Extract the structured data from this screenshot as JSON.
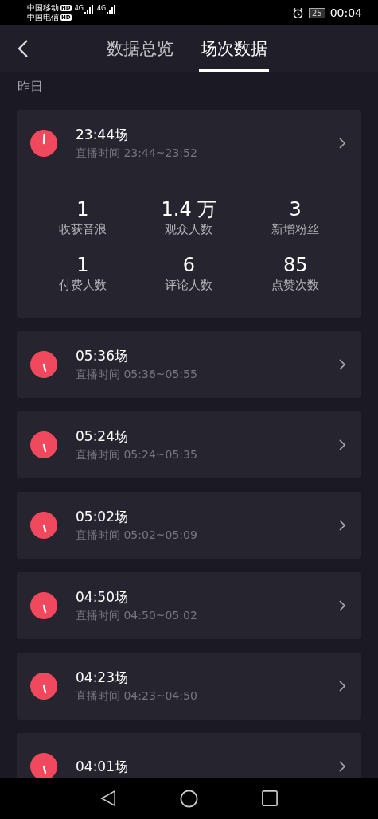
{
  "status_bar": {
    "carriers": [
      {
        "name": "中国移动",
        "badge": "HD",
        "network": "4G"
      },
      {
        "name": "中国电信",
        "badge": "HD",
        "network": "4G"
      }
    ],
    "battery": "25",
    "time": "00:04"
  },
  "tabs": [
    {
      "label": "数据总览",
      "selected": false
    },
    {
      "label": "场次数据",
      "selected": true
    }
  ],
  "section_label": "昨日",
  "sessions": [
    {
      "title": "23:44场",
      "subtitle": "直播时间 23:44~23:52",
      "expanded": true,
      "stats": [
        {
          "value": "1",
          "label": "收获音浪"
        },
        {
          "value": "1.4 万",
          "label": "观众人数"
        },
        {
          "value": "3",
          "label": "新增粉丝"
        },
        {
          "value": "1",
          "label": "付费人数"
        },
        {
          "value": "6",
          "label": "评论人数"
        },
        {
          "value": "85",
          "label": "点赞次数"
        }
      ]
    },
    {
      "title": "05:36场",
      "subtitle": "直播时间 05:36~05:55",
      "expanded": false
    },
    {
      "title": "05:24场",
      "subtitle": "直播时间 05:24~05:35",
      "expanded": false
    },
    {
      "title": "05:02场",
      "subtitle": "直播时间 05:02~05:09",
      "expanded": false
    },
    {
      "title": "04:50场",
      "subtitle": "直播时间 04:50~05:02",
      "expanded": false
    },
    {
      "title": "04:23场",
      "subtitle": "直播时间 04:23~04:50",
      "expanded": false
    },
    {
      "title": "04:01场",
      "expanded": false
    }
  ]
}
